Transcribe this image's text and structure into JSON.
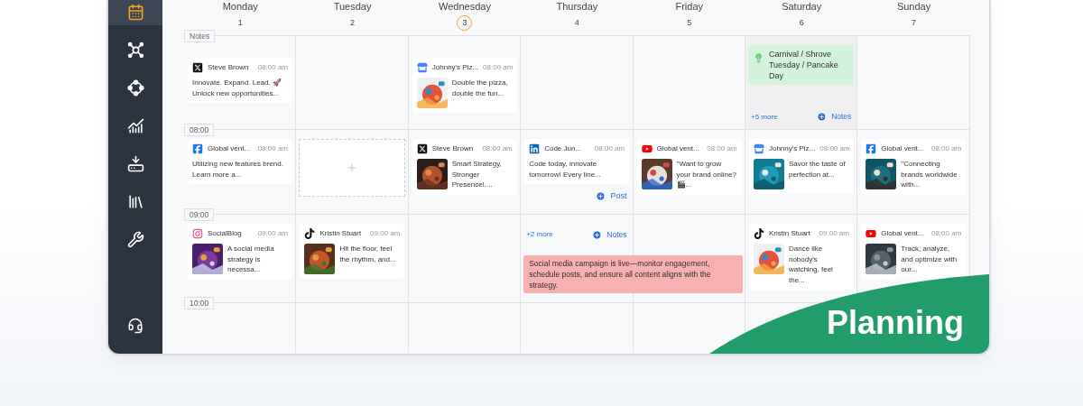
{
  "sidebar": {
    "items": [
      {
        "selected": true
      },
      {
        "selected": false
      },
      {
        "selected": false
      },
      {
        "selected": false
      },
      {
        "selected": false
      },
      {
        "selected": false
      },
      {
        "selected": false
      }
    ]
  },
  "days": [
    {
      "name": "Monday",
      "date": "1",
      "selected": false
    },
    {
      "name": "Tuesday",
      "date": "2",
      "selected": false
    },
    {
      "name": "Wednesday",
      "date": "3",
      "selected": true
    },
    {
      "name": "Thursday",
      "date": "4",
      "selected": false
    },
    {
      "name": "Friday",
      "date": "5",
      "selected": false
    },
    {
      "name": "Saturday",
      "date": "6",
      "selected": false
    },
    {
      "name": "Sunday",
      "date": "7",
      "selected": false
    }
  ],
  "rows": [
    {
      "label": "Notes",
      "kind": "notes",
      "cells": [
        {
          "kind": "post",
          "channel": {
            "kind": "x"
          },
          "author": "Steve Brown",
          "time": "08:00 am",
          "text": "Innovate. Expand. Lead. 🚀 Unlock new opportunities..."
        },
        {
          "kind": "empty"
        },
        {
          "kind": "post",
          "channel": {
            "kind": "google-business"
          },
          "author": "Johnny's Piz...",
          "time": "08:00 am",
          "text": "Double the pizza, double the fun..."
        },
        {
          "kind": "empty"
        },
        {
          "kind": "empty"
        },
        {
          "kind": "day-notes",
          "holiday": "Carnival / Shrove Tuesday / Pancake Day",
          "more": "+5 more",
          "action": "Notes"
        },
        {
          "kind": "empty"
        }
      ]
    },
    {
      "label": "08:00",
      "kind": "time",
      "cells": [
        {
          "kind": "post",
          "channel": {
            "kind": "facebook"
          },
          "author": "Global vent...",
          "time": "08:00 am",
          "text": "Utilizing new features brend. Learn more a..."
        },
        {
          "kind": "add-slot"
        },
        {
          "kind": "post",
          "channel": {
            "kind": "x"
          },
          "author": "Steve Brown",
          "time": "08:00 am",
          "text": "Smart Strategy, Stronger Presence!...."
        },
        {
          "kind": "post",
          "channel": {
            "kind": "linkedin"
          },
          "author": "Code Jun...",
          "time": "08:00 am",
          "text": "Code today, innovate tomorrow! Every line...",
          "action": "Post"
        },
        {
          "kind": "post",
          "channel": {
            "kind": "youtube"
          },
          "author": "Global vent...",
          "time": "08:00 am",
          "text": "\"Want to grow your brand online? 🎬..."
        },
        {
          "kind": "post",
          "channel": {
            "kind": "google-business"
          },
          "author": "Johnny's Piz...",
          "time": "08:00 am",
          "text": "Savor the taste of perfection at..."
        },
        {
          "kind": "post",
          "channel": {
            "kind": "facebook"
          },
          "author": "Global vent...",
          "time": "08:00 am",
          "text": "\"Connecting brands worldwide with..."
        }
      ]
    },
    {
      "label": "09:00",
      "kind": "time",
      "cells": [
        {
          "kind": "post",
          "channel": {
            "kind": "instagram"
          },
          "author": "SocialBlog",
          "time": "09:00 am",
          "text": "A social media strategy is necessa..."
        },
        {
          "kind": "post",
          "channel": {
            "kind": "tiktok"
          },
          "author": "Kristin Stuart",
          "time": "09:00 am",
          "text": "Hit the floor, feel the rhythm, and..."
        },
        {
          "kind": "empty"
        },
        {
          "kind": "more-notes",
          "more": "+2 more",
          "action": "Notes",
          "note": "Social media campaign is live—monitor engagement, schedule posts, and ensure all content aligns with the strategy."
        },
        {
          "kind": "empty"
        },
        {
          "kind": "post",
          "channel": {
            "kind": "tiktok"
          },
          "author": "Kristin Stuart",
          "time": "09:00 am",
          "text": "Dance like nobody's watching, feel the..."
        },
        {
          "kind": "post",
          "channel": {
            "kind": "youtube"
          },
          "author": "Global vent...",
          "time": "08:00 am",
          "text": "Track, analyze, and optimize with our..."
        }
      ]
    },
    {
      "label": "10:00",
      "kind": "time",
      "cells": [
        {
          "kind": "empty"
        },
        {
          "kind": "empty"
        },
        {
          "kind": "empty"
        },
        {
          "kind": "empty"
        },
        {
          "kind": "empty"
        },
        {
          "kind": "empty"
        },
        {
          "kind": "empty"
        }
      ]
    }
  ],
  "banner": {
    "text": "Planning"
  }
}
